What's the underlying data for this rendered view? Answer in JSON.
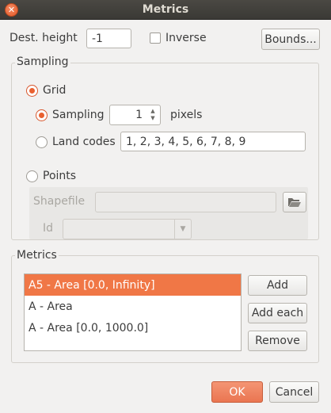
{
  "window": {
    "title": "Metrics"
  },
  "dest_height": {
    "label": "Dest. height",
    "value": "-1"
  },
  "inverse": {
    "label": "Inverse",
    "checked": false
  },
  "bounds_button": {
    "label": "Bounds..."
  },
  "sampling": {
    "title": "Sampling",
    "grid": {
      "label": "Grid",
      "selected": true
    },
    "sampling_option": {
      "label": "Sampling",
      "value": "1",
      "unit": "pixels",
      "selected": true
    },
    "land_codes": {
      "label": "Land codes",
      "value": "1, 2, 3, 4, 5, 6, 7, 8, 9",
      "selected": false
    },
    "points": {
      "label": "Points",
      "selected": false
    },
    "shapefile": {
      "label": "Shapefile",
      "value": ""
    },
    "id": {
      "label": "Id",
      "value": ""
    }
  },
  "metrics": {
    "title": "Metrics",
    "items": [
      {
        "label": "A5 - Area [0.0, Infinity]",
        "selected": true
      },
      {
        "label": "A - Area",
        "selected": false
      },
      {
        "label": "A - Area [0.0, 1000.0]",
        "selected": false
      }
    ],
    "add_label": "Add",
    "add_each_label": "Add each",
    "remove_label": "Remove"
  },
  "footer": {
    "ok_label": "OK",
    "cancel_label": "Cancel"
  },
  "colors": {
    "accent": "#f07746",
    "titlebar": "#3c3b37"
  },
  "icons": {
    "close": "close-icon",
    "folder": "folder-open-icon",
    "dropdown": "chevron-down-icon",
    "spin": "spin-arrows-icon"
  }
}
